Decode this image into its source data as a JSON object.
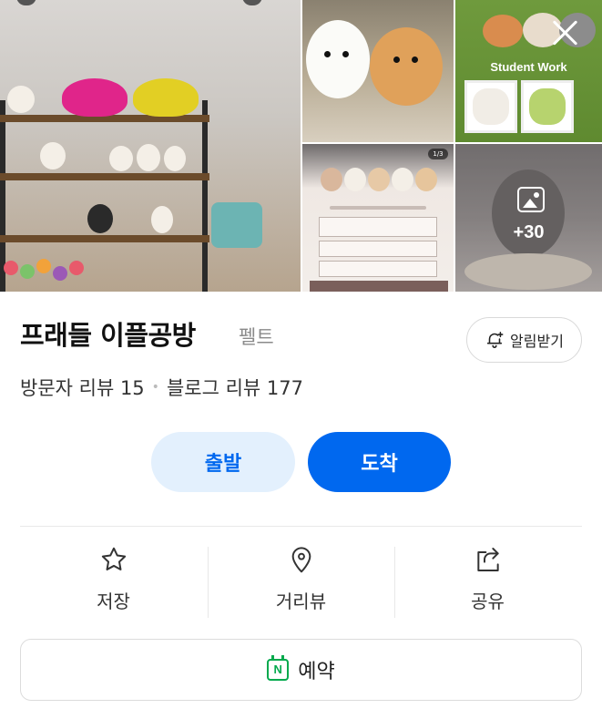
{
  "gallery": {
    "student_work_label": "Student Work",
    "flyer_page_indicator": "1/3",
    "more_photos_count": "+30",
    "close_icon": "close-icon",
    "more_icon": "image-icon"
  },
  "place": {
    "name": "프래들 이플공방",
    "category": "펠트",
    "alarm_label": "알림받기",
    "alarm_icon": "bell-plus-icon",
    "reviews": {
      "visitor": "방문자 리뷰 15",
      "blog": "블로그 리뷰 177"
    }
  },
  "actions": {
    "depart_label": "출발",
    "arrive_label": "도착"
  },
  "menu": [
    {
      "label": "저장",
      "icon": "star-icon"
    },
    {
      "label": "거리뷰",
      "icon": "location-pin-icon"
    },
    {
      "label": "공유",
      "icon": "share-icon"
    }
  ],
  "reserve": {
    "label": "예약",
    "icon": "naver-calendar-icon"
  },
  "colors": {
    "accent": "#0068ef",
    "accent_light": "#e3f0fd",
    "naver_green": "#03a94d"
  }
}
